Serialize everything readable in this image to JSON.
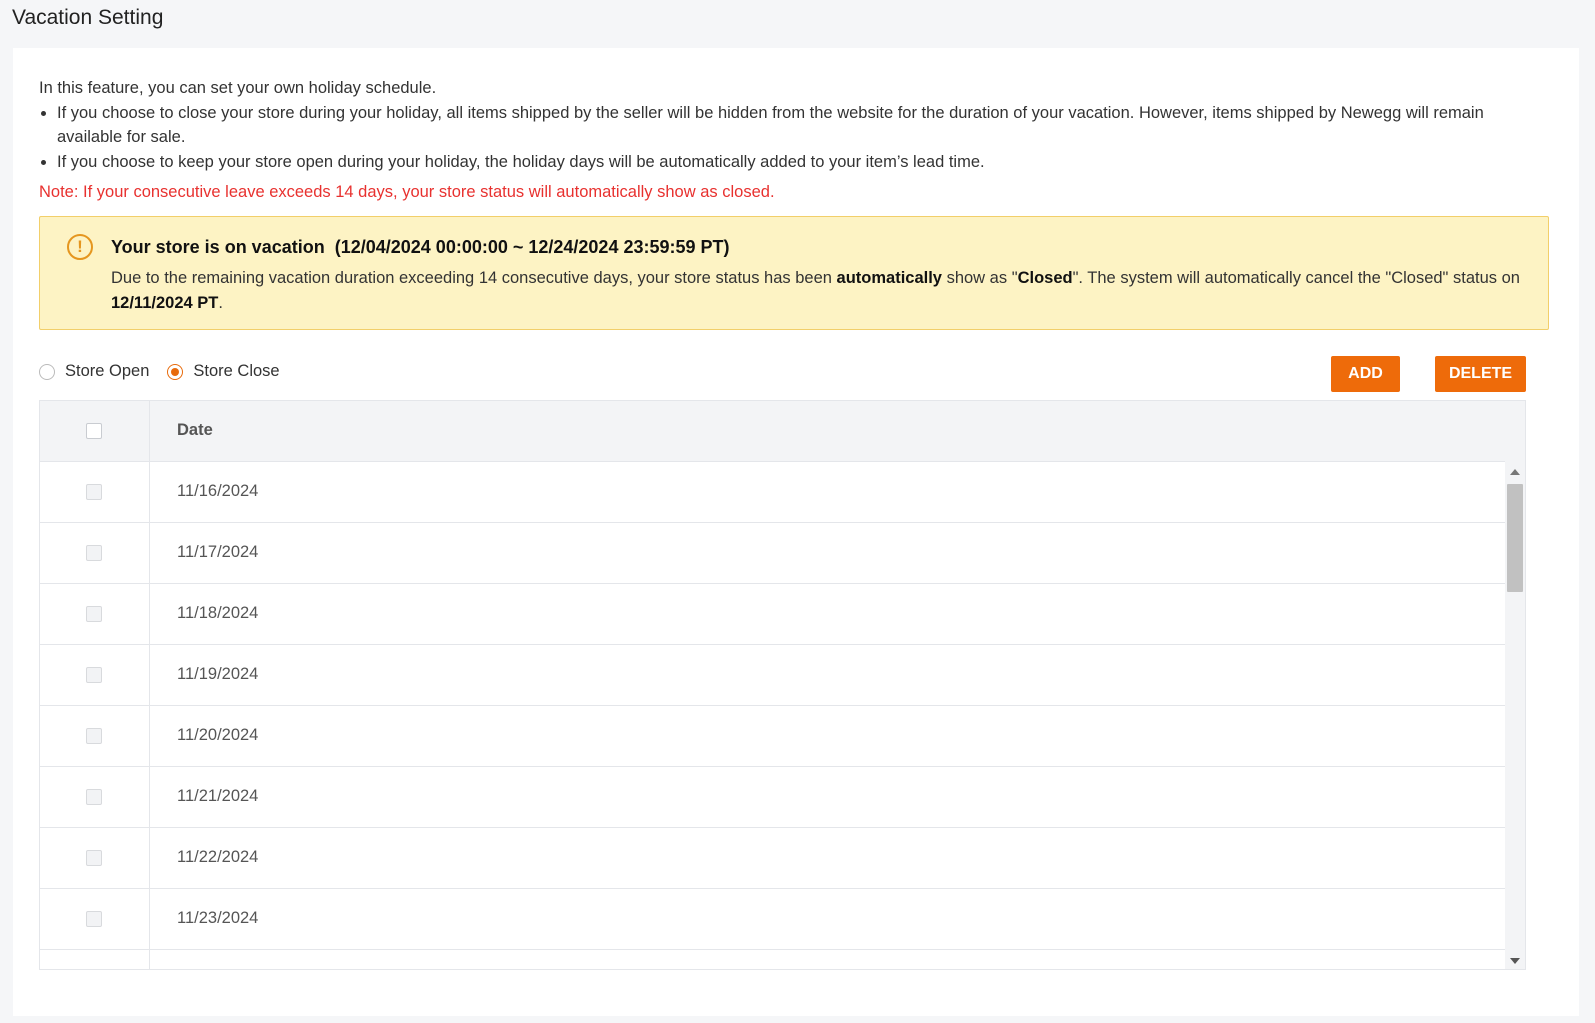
{
  "page": {
    "title": "Vacation Setting"
  },
  "intro": {
    "lead": "In this feature, you can set your own holiday schedule.",
    "bullets": [
      "If you choose to close your store during your holiday, all items shipped by the seller will be hidden from the website for the duration of your vacation. However, items shipped by Newegg will remain available for sale.",
      "If you choose to keep your store open during your holiday, the holiday days will be automatically added to your item’s lead time."
    ],
    "note": "Note: If your consecutive leave exceeds 14 days, your store status will automatically show as closed."
  },
  "alert": {
    "icon": "exclamation-icon",
    "title": "Your store is on vacation",
    "range": "(12/04/2024 00:00:00 ~ 12/24/2024 23:59:59 PT)",
    "body_1": "Due to the remaining vacation duration exceeding 14 consecutive days, your store status has been ",
    "body_bold_1": "automatically",
    "body_2": " show as \"",
    "body_bold_2": "Closed",
    "body_3": "\". The system will automatically cancel the \"Closed\" status on ",
    "body_bold_3": "12/11/2024 PT",
    "body_4": "."
  },
  "mode": {
    "options": [
      {
        "label": "Store Open",
        "checked": false
      },
      {
        "label": "Store Close",
        "checked": true
      }
    ]
  },
  "toolbar": {
    "add_label": "ADD",
    "delete_label": "DELETE"
  },
  "table": {
    "header_date": "Date",
    "rows": [
      "11/16/2024",
      "11/17/2024",
      "11/18/2024",
      "11/19/2024",
      "11/20/2024",
      "11/21/2024",
      "11/22/2024",
      "11/23/2024",
      ""
    ]
  },
  "colors": {
    "accent": "#ee6b0a",
    "note": "#e8312f",
    "alert_bg": "#fdf3c4",
    "alert_border": "#f2cf6a"
  }
}
